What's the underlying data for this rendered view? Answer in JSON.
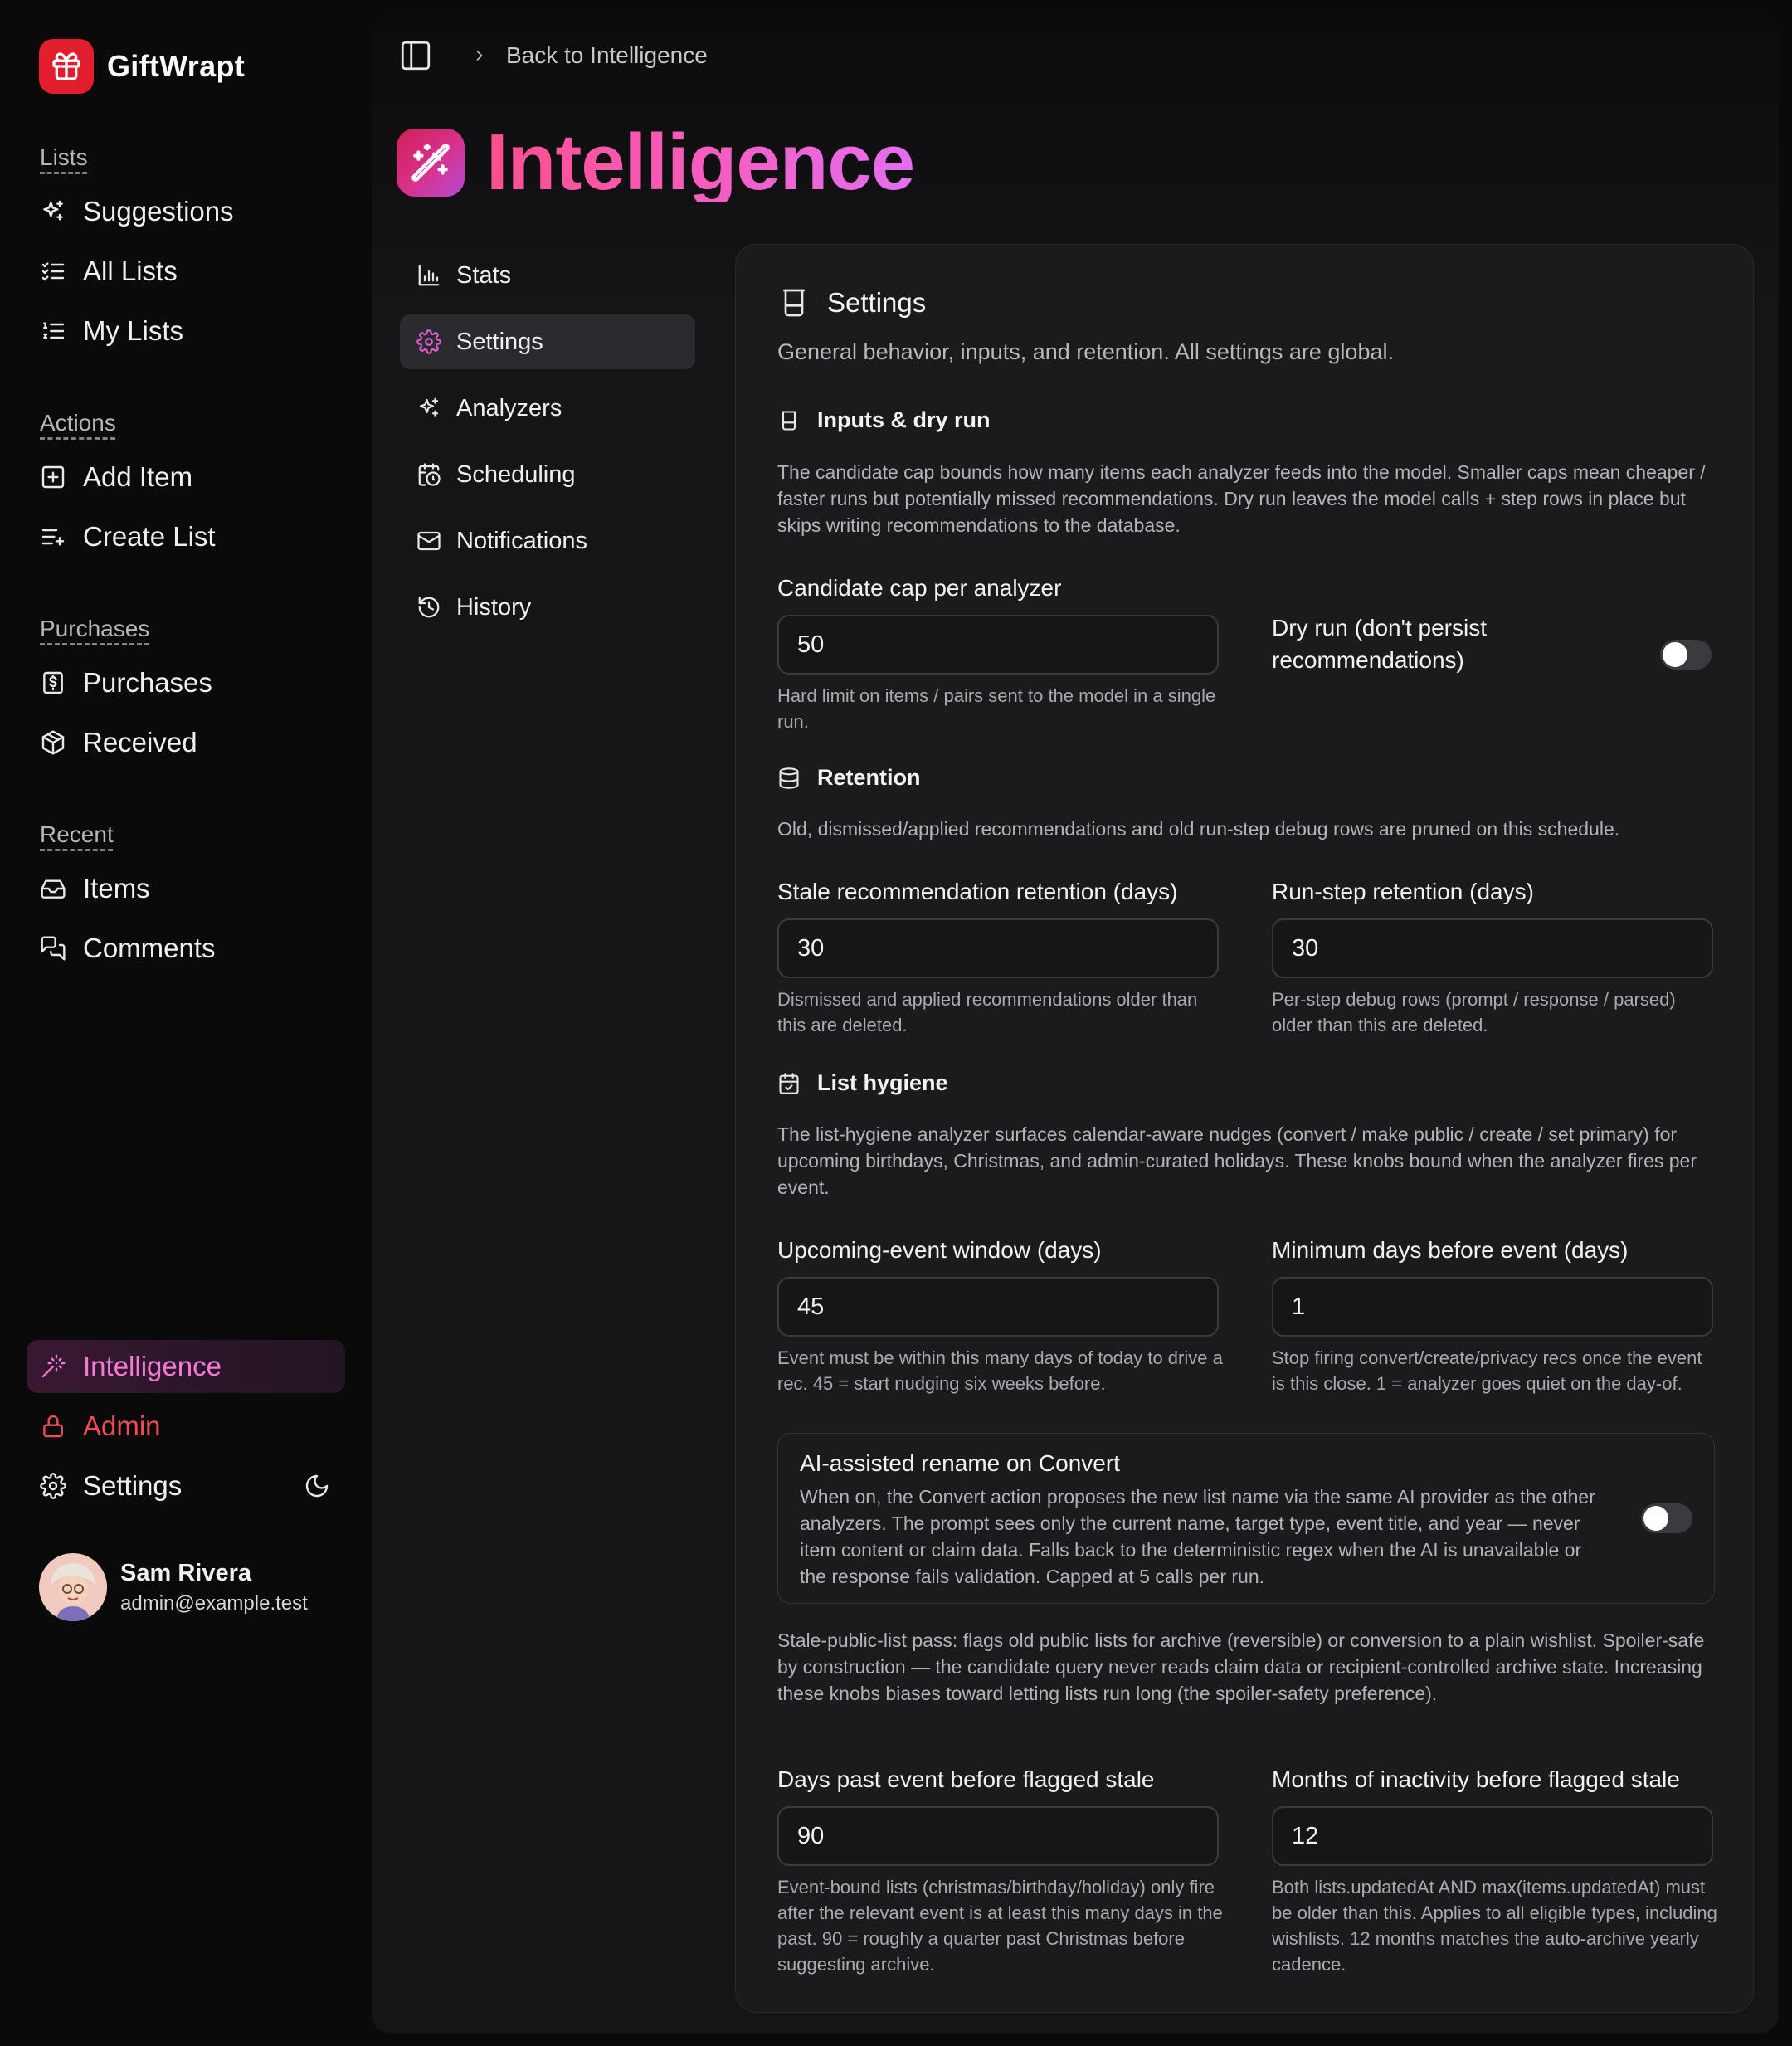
{
  "brand": {
    "name": "GiftWrapt"
  },
  "sidebar": {
    "groups": [
      {
        "label": "Lists",
        "items": [
          {
            "label": "Suggestions",
            "icon": "sparkles-icon"
          },
          {
            "label": "All Lists",
            "icon": "list-checks-icon"
          },
          {
            "label": "My Lists",
            "icon": "list-ordered-icon"
          }
        ]
      },
      {
        "label": "Actions",
        "items": [
          {
            "label": "Add Item",
            "icon": "square-plus-icon"
          },
          {
            "label": "Create List",
            "icon": "list-plus-icon"
          }
        ]
      },
      {
        "label": "Purchases",
        "items": [
          {
            "label": "Purchases",
            "icon": "receipt-icon"
          },
          {
            "label": "Received",
            "icon": "package-open-icon"
          }
        ]
      },
      {
        "label": "Recent",
        "items": [
          {
            "label": "Items",
            "icon": "inbox-icon"
          },
          {
            "label": "Comments",
            "icon": "messages-icon"
          }
        ]
      }
    ],
    "bottom": {
      "intelligence": "Intelligence",
      "admin": "Admin",
      "settings": "Settings"
    },
    "user": {
      "name": "Sam Rivera",
      "email": "admin@example.test"
    }
  },
  "topbar": {
    "back_label": "Back to Intelligence"
  },
  "page": {
    "title": "Intelligence"
  },
  "subnav": [
    {
      "label": "Stats",
      "icon": "bar-chart-icon"
    },
    {
      "label": "Settings",
      "icon": "gear-icon",
      "active": true
    },
    {
      "label": "Analyzers",
      "icon": "sparkles-icon"
    },
    {
      "label": "Scheduling",
      "icon": "calendar-clock-icon"
    },
    {
      "label": "Notifications",
      "icon": "mail-icon"
    },
    {
      "label": "History",
      "icon": "history-icon"
    }
  ],
  "card": {
    "title": "Settings",
    "description": "General behavior, inputs, and retention. All settings are global.",
    "inputs": {
      "title": "Inputs & dry run",
      "description": "The candidate cap bounds how many items each analyzer feeds into the model. Smaller caps mean cheaper / faster runs but potentially missed recommendations. Dry run leaves the model calls + step rows in place but skips writing recommendations to the database.",
      "cap_label": "Candidate cap per analyzer",
      "cap_value": "50",
      "cap_hint": "Hard limit on items / pairs sent to the model in a single run.",
      "dry_run_label": "Dry run (don't persist recommendations)",
      "dry_run_on": false
    },
    "retention": {
      "title": "Retention",
      "description": "Old, dismissed/applied recommendations and old run-step debug rows are pruned on this schedule.",
      "stale_label": "Stale recommendation retention (days)",
      "stale_value": "30",
      "stale_hint": "Dismissed and applied recommendations older than this are deleted.",
      "step_label": "Run-step retention (days)",
      "step_value": "30",
      "step_hint": "Per-step debug rows (prompt / response / parsed) older than this are deleted."
    },
    "hygiene": {
      "title": "List hygiene",
      "description": "The list-hygiene analyzer surfaces calendar-aware nudges (convert / make public / create / set primary) for upcoming birthdays, Christmas, and admin-curated holidays. These knobs bound when the analyzer fires per event.",
      "window_label": "Upcoming-event window (days)",
      "window_value": "45",
      "window_hint": "Event must be within this many days of today to drive a rec. 45 = start nudging six weeks before.",
      "min_label": "Minimum days before event (days)",
      "min_value": "1",
      "min_hint": "Stop firing convert/create/privacy recs once the event is this close. 1 = analyzer goes quiet on the day-of.",
      "rename_title": "AI-assisted rename on Convert",
      "rename_desc": "When on, the Convert action proposes the new list name via the same AI provider as the other analyzers. The prompt sees only the current name, target type, event title, and year — never item content or claim data. Falls back to the deterministic regex when the AI is unavailable or the response fails validation. Capped at 5 calls per run.",
      "rename_on": false,
      "stale_desc": "Stale-public-list pass: flags old public lists for archive (reversible) or conversion to a plain wishlist. Spoiler-safe by construction — the candidate query never reads claim data or recipient-controlled archive state. Increasing these knobs biases toward letting lists run long (the spoiler-safety preference).",
      "days_past_label": "Days past event before flagged stale",
      "days_past_value": "90",
      "days_past_hint": "Event-bound lists (christmas/birthday/holiday) only fire after the relevant event is at least this many days in the past. 90 = roughly a quarter past Christmas before suggesting archive.",
      "months_label": "Months of inactivity before flagged stale",
      "months_value": "12",
      "months_hint": "Both lists.updatedAt AND max(items.updatedAt) must be older than this. Applies to all eligible types, including wishlists. 12 months matches the auto-archive yearly cadence."
    }
  },
  "colors": {
    "accent": "#f07ad6",
    "brand": "#e21d2d",
    "danger": "#f04a57"
  }
}
